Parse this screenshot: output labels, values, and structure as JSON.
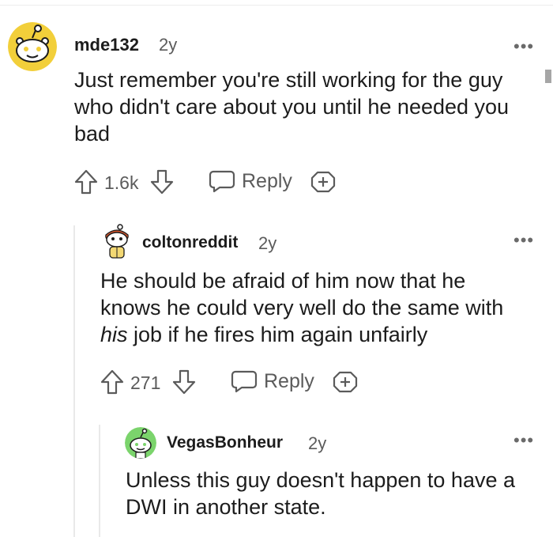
{
  "comments": [
    {
      "username": "mde132",
      "age": "2y",
      "text_lines": [
        "Just remember you're still working for the guy",
        "who didn't care about you until he needed you",
        "bad"
      ],
      "votes": "1.6k",
      "reply_label": "Reply",
      "more_label": "•••"
    },
    {
      "username": "coltonreddit",
      "age": "2y",
      "text_line1": "He should be afraid of him now that he",
      "text_line2": "knows he could very well do the same with",
      "text_line3_em": "his",
      "text_line3_rest": " job if he fires him again unfairly",
      "votes": "271",
      "reply_label": "Reply",
      "more_label": "•••"
    },
    {
      "username": "VegasBonheur",
      "age": "2y",
      "text_lines": [
        "Unless this guy doesn't happen to have a",
        "DWI in another state."
      ],
      "more_label": "•••"
    }
  ],
  "colors": {
    "text": "#1c1c1c",
    "meta": "#5b5b5b",
    "avatar1": "#f2cf3a",
    "avatar3": "#7bd46c",
    "thread_line": "#e9e9e9"
  }
}
